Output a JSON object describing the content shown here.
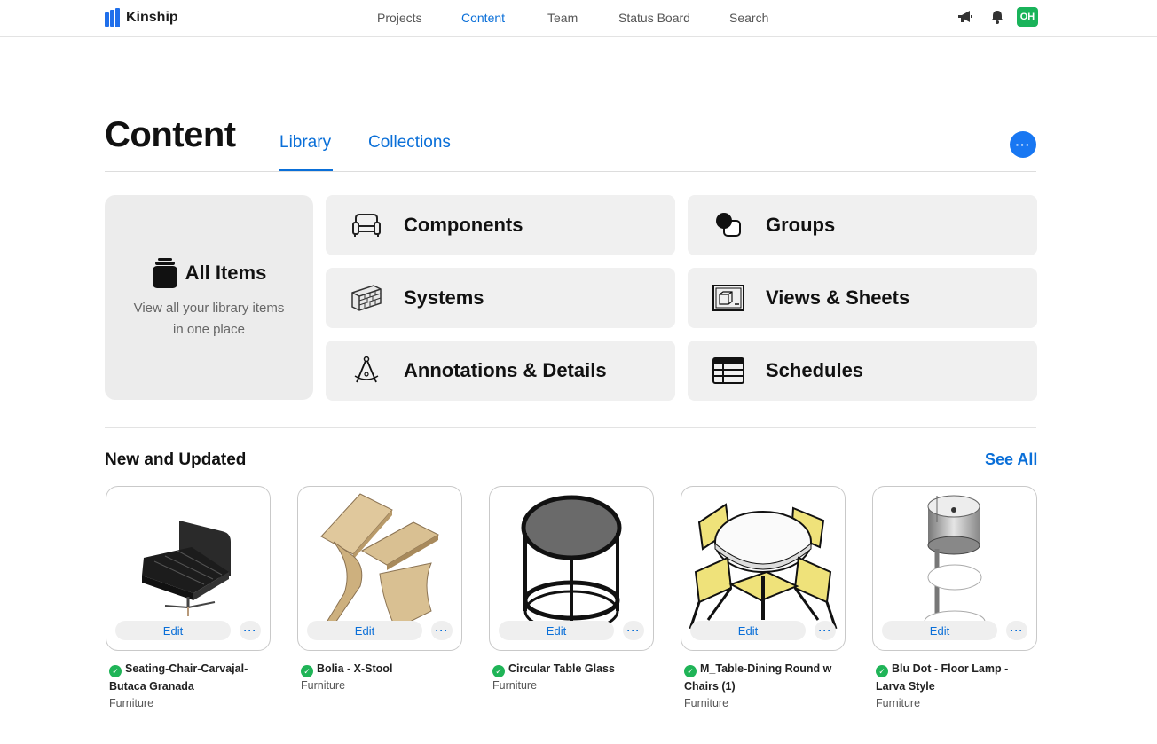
{
  "app": {
    "name": "Kinship"
  },
  "nav": {
    "links": [
      {
        "label": "Projects"
      },
      {
        "label": "Content"
      },
      {
        "label": "Team"
      },
      {
        "label": "Status Board"
      },
      {
        "label": "Search"
      }
    ],
    "active": "Content",
    "avatar_initials": "OH",
    "icons": [
      "megaphone-icon",
      "bell-icon"
    ]
  },
  "header": {
    "title": "Content",
    "tabs": [
      {
        "label": "Library"
      },
      {
        "label": "Collections"
      }
    ],
    "active_tab": "Library",
    "more_label": "···"
  },
  "library": {
    "all_items": {
      "title": "All Items",
      "description": "View all your library items in one place",
      "icon": "all-items-icon"
    },
    "categories": [
      {
        "label": "Components",
        "icon": "armchair-icon"
      },
      {
        "label": "Groups",
        "icon": "groups-icon"
      },
      {
        "label": "Systems",
        "icon": "brick-wall-icon"
      },
      {
        "label": "Views & Sheets",
        "icon": "views-sheets-icon"
      },
      {
        "label": "Annotations & Details",
        "icon": "compass-icon"
      },
      {
        "label": "Schedules",
        "icon": "table-icon"
      }
    ]
  },
  "new_and_updated": {
    "title": "New and Updated",
    "see_all_label": "See All",
    "edit_label": "Edit",
    "more_label": "···",
    "items": [
      {
        "name": "Seating-Chair-Carvajal-Butaca Granada",
        "category": "Furniture"
      },
      {
        "name": "Bolia - X-Stool",
        "category": "Furniture"
      },
      {
        "name": "Circular Table Glass",
        "category": "Furniture"
      },
      {
        "name": "M_Table-Dining Round w Chairs (1)",
        "category": "Furniture"
      },
      {
        "name": "Blu Dot - Floor Lamp - Larva Style",
        "category": "Furniture"
      }
    ]
  },
  "colors": {
    "accent": "#0a6fd8",
    "button_blue": "#1877f2",
    "avatar_green": "#19b35a",
    "check_green": "#1fb457",
    "tile_bg": "#f0f0f0"
  }
}
